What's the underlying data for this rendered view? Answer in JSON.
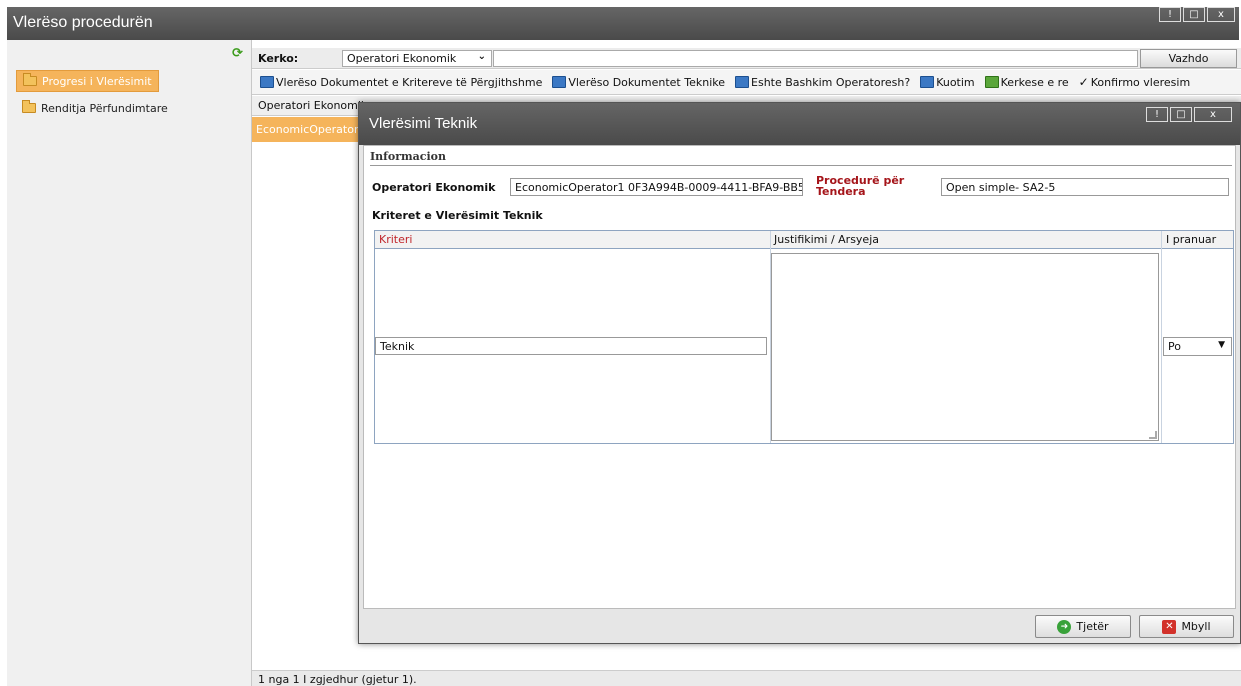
{
  "window": {
    "title": "Vlerëso procedurën",
    "controls": [
      "!",
      "□",
      "x"
    ]
  },
  "sidebar": {
    "items": [
      {
        "label": "Progresi i Vlerësimit",
        "selected": true
      },
      {
        "label": "Renditja Përfundimtare",
        "selected": false
      }
    ]
  },
  "search": {
    "label": "Kerko:",
    "field_value": "Operatori Ekonomik",
    "query": "",
    "button": "Vazhdo"
  },
  "toolbar": {
    "items": [
      "Vlerëso Dokumentet e Kritereve të Përgjithshme",
      "Vlerëso Dokumentet Teknike",
      "Eshte Bashkim Operatoresh?",
      "Kuotim",
      "Kerkese e re",
      "Konfirmo vleresim"
    ]
  },
  "grid": {
    "column": "Operatori Ekonomik",
    "row": "EconomicOperator"
  },
  "status": "1 nga 1 I zgjedhur (gjetur 1).",
  "dialog": {
    "title": "Vlerësimi Teknik",
    "section": "Informacion",
    "operator_label": "Operatori Ekonomik",
    "operator_value": "EconomicOperator1 0F3A994B-0009-4411-BFA9-BB5",
    "procedure_label": "Procedurë për Tendera",
    "procedure_value": "Open simple- SA2-5",
    "criteria_title": "Kriteret e Vlerësimit Teknik",
    "table": {
      "headers": [
        "Kriteri",
        "Justifikimi / Arsyeja",
        "I pranuar"
      ],
      "rows": [
        {
          "kriteri": "Teknik",
          "justifikimi": "",
          "pranuar": "Po"
        }
      ]
    },
    "buttons": {
      "next": "Tjetër",
      "close": "Mbyll"
    }
  },
  "colors": {
    "selection": "#f5b45b",
    "titlebar": "#4a4a4a",
    "required_label": "#a5151a"
  }
}
